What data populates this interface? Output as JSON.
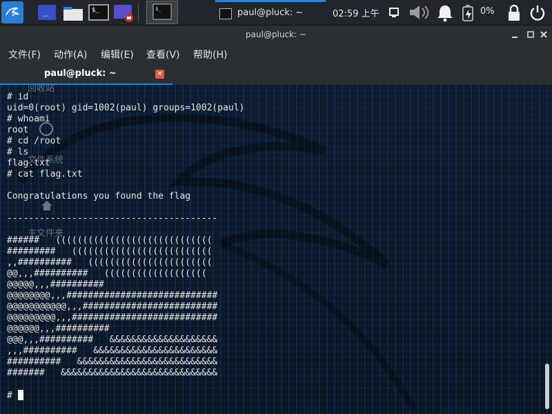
{
  "panel": {
    "task_title": "paul@pluck: ~",
    "clock": "02:59 上午",
    "battery_percent": "0%",
    "accent_color": "#1e88e5"
  },
  "window": {
    "title": "paul@pluck: ~",
    "controls": [
      "minimize-icon",
      "maximize-icon",
      "close-icon"
    ]
  },
  "menu": [
    "文件(F)",
    "动作(A)",
    "编辑(E)",
    "查看(V)",
    "帮助(H)"
  ],
  "tab": {
    "title": "paul@pluck: ~",
    "close_color": "#e05a3b"
  },
  "desktop_icons": [
    "回收站",
    "文件系统",
    "主文件夹"
  ],
  "terminal": {
    "lines": [
      "# id",
      "uid=0(root) gid=1002(paul) groups=1002(paul)",
      "# whoami",
      "root",
      "# cd /root",
      "# ls",
      "flag.txt",
      "# cat flag.txt",
      "",
      "Congratulations you found the flag",
      "",
      "---------------------------------------",
      "",
      "######   (((((((((((((((((((((((((((((",
      "#########   ((((((((((((((((((((((((((",
      ",,##########   (((((((((((((((((((((((",
      "@@,,,##########   (((((((((((((((((((",
      "@@@@@,,,##########",
      "@@@@@@@@,,,############################",
      "@@@@@@@@@@@,,,#########################",
      "@@@@@@@@@,,,###########################",
      "@@@@@@,,,##########",
      "@@@,,,##########   &&&&&&&&&&&&&&&&&&&&",
      ",,,##########   &&&&&&&&&&&&&&&&&&&&&&&",
      "##########   &&&&&&&&&&&&&&&&&&&&&&&&&&",
      "#######   &&&&&&&&&&&&&&&&&&&&&&&&&&&&&",
      "",
      "# "
    ]
  }
}
